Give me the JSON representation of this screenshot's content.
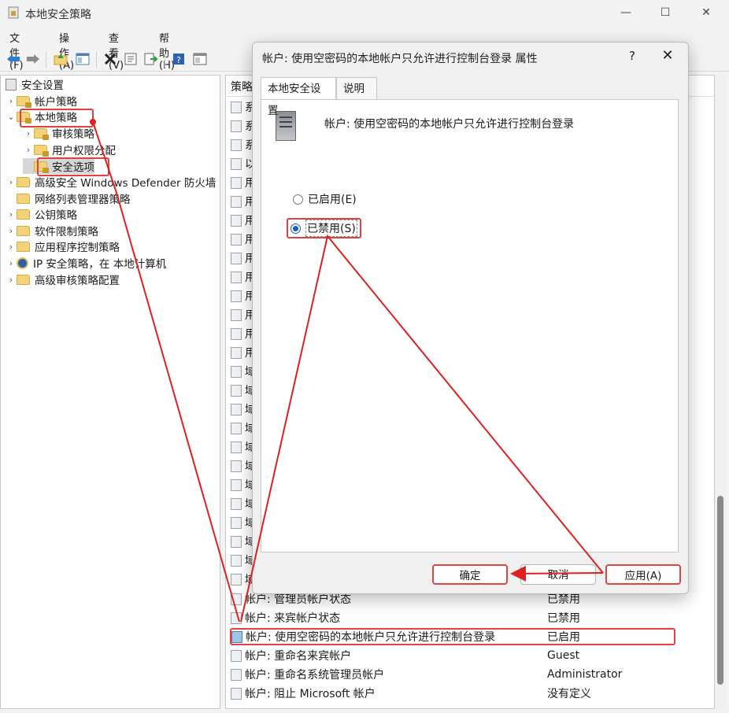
{
  "window": {
    "title": "本地安全策略",
    "minimize_glyph": "—",
    "maximize_glyph": "☐",
    "close_glyph": "✕"
  },
  "menu": [
    "文件(F)",
    "操作(A)",
    "查看(V)",
    "帮助(H)"
  ],
  "toolbar_icons": [
    "back-arrow-icon",
    "forward-arrow-icon",
    "up-folder-icon",
    "show-hide-tree-icon",
    "delete-icon",
    "properties-icon",
    "export-list-icon",
    "help-icon",
    "console-icon"
  ],
  "tree": {
    "root": "安全设置",
    "items": [
      {
        "label": "帐户策略",
        "chevron": "›"
      },
      {
        "label": "本地策略",
        "chevron": "⌄"
      },
      {
        "label": "审核策略",
        "chevron": "›"
      },
      {
        "label": "用户权限分配",
        "chevron": "›"
      },
      {
        "label": "安全选项",
        "chevron": ""
      },
      {
        "label": "高级安全 Windows Defender 防火墙",
        "chevron": "›"
      },
      {
        "label": "网络列表管理器策略",
        "chevron": ""
      },
      {
        "label": "公钥策略",
        "chevron": "›"
      },
      {
        "label": "软件限制策略",
        "chevron": "›"
      },
      {
        "label": "应用程序控制策略",
        "chevron": "›"
      },
      {
        "label": "IP 安全策略，在 本地计算机",
        "chevron": "›"
      },
      {
        "label": "高级审核策略配置",
        "chevron": "›"
      }
    ]
  },
  "list": {
    "header_policy": "策略",
    "partial_rows": [
      "系",
      "系",
      "系",
      "以",
      "用",
      "用",
      "用",
      "用",
      "用",
      "用",
      "用",
      "用",
      "用",
      "用",
      "域",
      "域",
      "域",
      "域",
      "域",
      "域",
      "域",
      "域",
      "域",
      "域",
      "域",
      "域"
    ],
    "rows": [
      {
        "name": "帐户: 管理员帐户状态",
        "value": "已禁用"
      },
      {
        "name": "帐户: 来宾帐户状态",
        "value": "已禁用"
      },
      {
        "name": "帐户: 使用空密码的本地帐户只允许进行控制台登录",
        "value": "已启用"
      },
      {
        "name": "帐户: 重命名来宾帐户",
        "value": "Guest"
      },
      {
        "name": "帐户: 重命名系统管理员帐户",
        "value": "Administrator"
      },
      {
        "name": "帐户: 阻止 Microsoft 帐户",
        "value": "没有定义"
      }
    ]
  },
  "dialog": {
    "title": "帐户: 使用空密码的本地帐户只允许进行控制台登录 属性",
    "help": "?",
    "close": "✕",
    "tabs": [
      "本地安全设置",
      "说明"
    ],
    "policy_name": "帐户: 使用空密码的本地帐户只允许进行控制台登录",
    "options": [
      {
        "label": "已启用(E)",
        "checked": false
      },
      {
        "label": "已禁用(S)",
        "checked": true
      }
    ],
    "buttons": {
      "ok": "确定",
      "cancel": "取消",
      "apply": "应用(A)"
    }
  },
  "annotation_color": "#e02020"
}
